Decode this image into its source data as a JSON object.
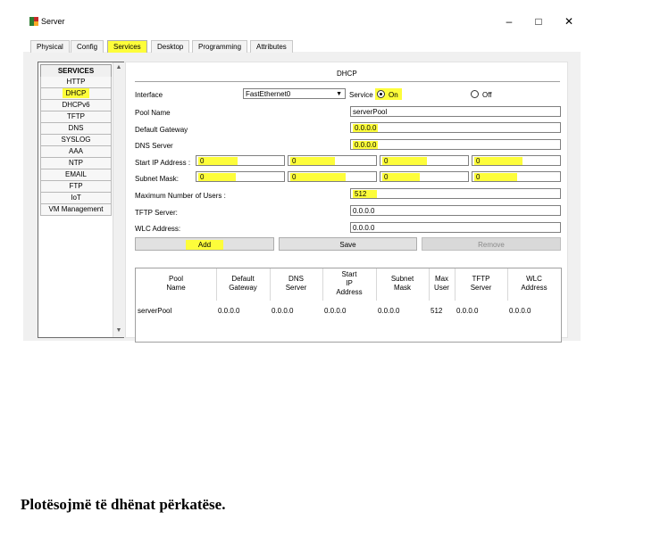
{
  "window": {
    "title": "Server",
    "minimize": "–",
    "maximize": "□",
    "close": "✕"
  },
  "tabs": [
    "Physical",
    "Config",
    "Services",
    "Desktop",
    "Programming",
    "Attributes"
  ],
  "active_tab": "Services",
  "sidebar": {
    "header": "SERVICES",
    "items": [
      "HTTP",
      "DHCP",
      "DHCPv6",
      "TFTP",
      "DNS",
      "SYSLOG",
      "AAA",
      "NTP",
      "EMAIL",
      "FTP",
      "IoT",
      "VM Management"
    ],
    "selected": "DHCP",
    "scroll_up": "▲",
    "scroll_down": "▼"
  },
  "dhcp": {
    "heading": "DHCP",
    "interface_label": "Interface",
    "interface_value": "FastEthernet0",
    "dropdown_arrow": "▼",
    "service_label": "Service",
    "on_label": "On",
    "off_label": "Off",
    "service_on": true,
    "pool_name_label": "Pool Name",
    "pool_name_value": "serverPool",
    "gateway_label": "Default Gateway",
    "gateway_value": "0.0.0.0",
    "dns_label": "DNS Server",
    "dns_value": "0.0.0.0",
    "start_ip_label": "Start IP Address :",
    "start_ip_octets": [
      "0",
      "0",
      "0",
      "0"
    ],
    "mask_label": "Subnet Mask:",
    "mask_octets": [
      "0",
      "0",
      "0",
      "0"
    ],
    "max_users_label": "Maximum Number of Users :",
    "max_users_value": "512",
    "tftp_label": "TFTP Server:",
    "tftp_value": "0.0.0.0",
    "wlc_label": "WLC Address:",
    "wlc_value": "0.0.0.0",
    "add_label": "Add",
    "save_label": "Save",
    "remove_label": "Remove"
  },
  "pool_table": {
    "headers": [
      "Pool\nName",
      "Default\nGateway",
      "DNS\nServer",
      "Start\nIP\nAddress",
      "Subnet\nMask",
      "Max\nUser",
      "TFTP\nServer",
      "WLC\nAddress"
    ],
    "rows": [
      [
        "serverPool",
        "0.0.0.0",
        "0.0.0.0",
        "0.0.0.0",
        "0.0.0.0",
        "512",
        "0.0.0.0",
        "0.0.0.0"
      ]
    ]
  },
  "note": "Plotësojmë të dhënat përkatëse.",
  "colors": {
    "highlight": "#fdfd3a",
    "window_bg": "#f0f0f0"
  }
}
